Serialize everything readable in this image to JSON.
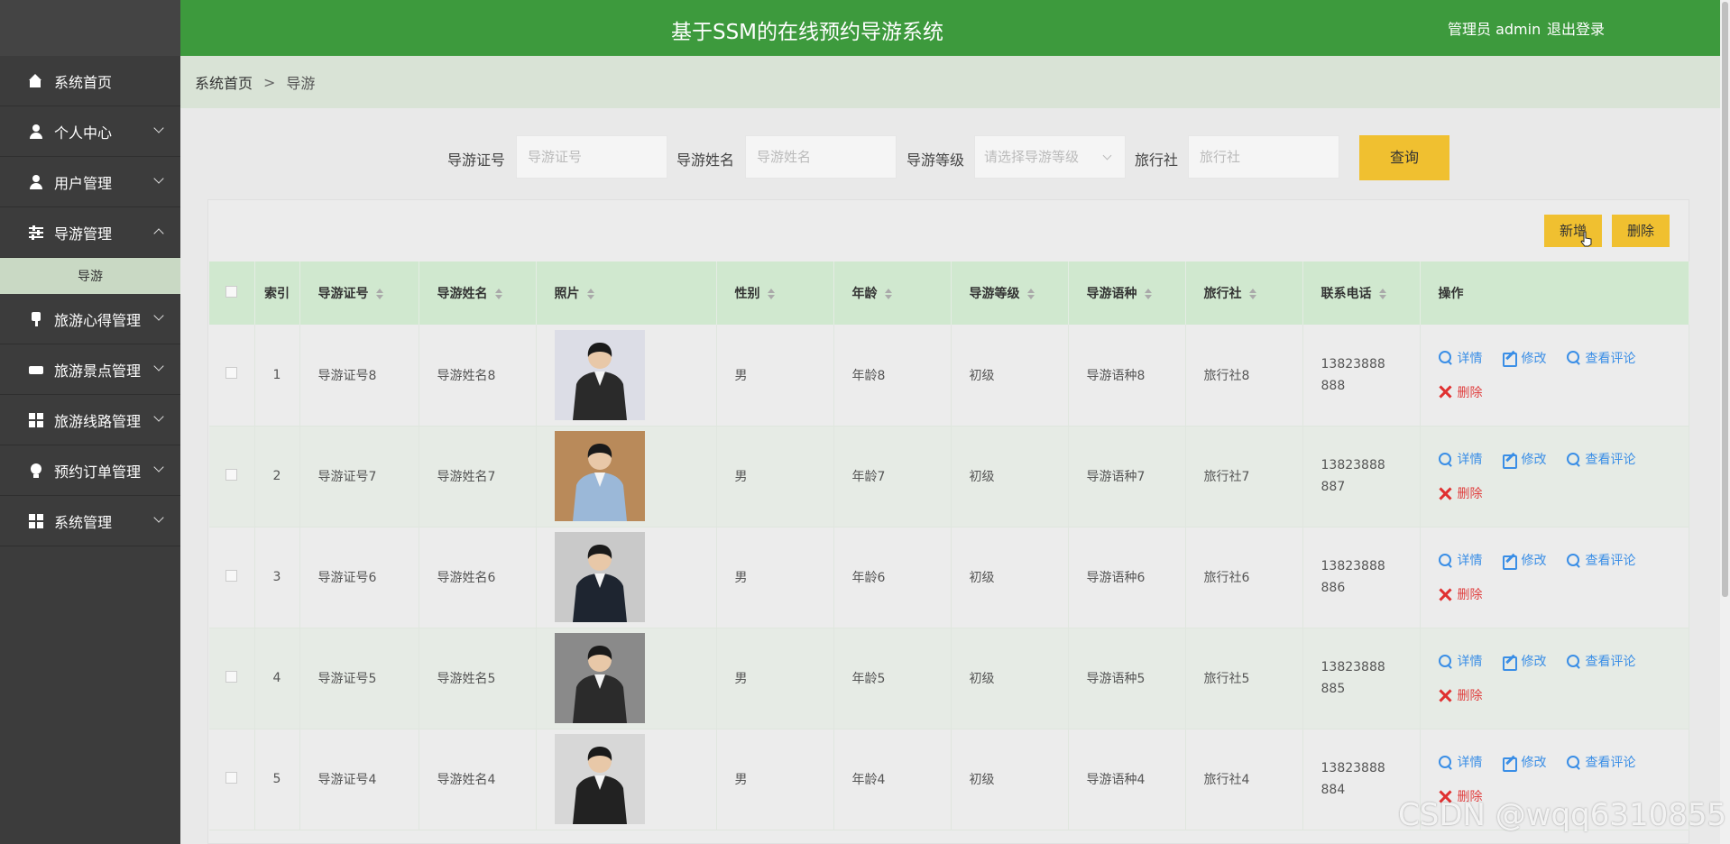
{
  "header": {
    "title": "基于SSM的在线预约导游系统",
    "user": "管理员 admin",
    "logout": "退出登录"
  },
  "sidebar": {
    "items": [
      {
        "label": "系统首页",
        "icon": "home-icon"
      },
      {
        "label": "个人中心",
        "icon": "user-icon"
      },
      {
        "label": "用户管理",
        "icon": "user-icon"
      },
      {
        "label": "导游管理",
        "icon": "sliders-icon"
      },
      {
        "label": "旅游心得管理",
        "icon": "pen-icon"
      },
      {
        "label": "旅游景点管理",
        "icon": "ticket-icon"
      },
      {
        "label": "旅游线路管理",
        "icon": "grid-icon"
      },
      {
        "label": "预约订单管理",
        "icon": "bulb-icon"
      },
      {
        "label": "系统管理",
        "icon": "grid-icon"
      }
    ],
    "sub_item": "导游"
  },
  "breadcrumb": {
    "home": "系统首页",
    "sep": ">",
    "current": "导游"
  },
  "search": {
    "id_label": "导游证号",
    "id_placeholder": "导游证号",
    "name_label": "导游姓名",
    "name_placeholder": "导游姓名",
    "level_label": "导游等级",
    "level_placeholder": "请选择导游等级",
    "agency_label": "旅行社",
    "agency_placeholder": "旅行社",
    "query_button": "查询"
  },
  "toolbar": {
    "add": "新增",
    "delete": "删除"
  },
  "table": {
    "headers": {
      "index": "索引",
      "guide_id": "导游证号",
      "guide_name": "导游姓名",
      "photo": "照片",
      "gender": "性别",
      "age": "年龄",
      "level": "导游等级",
      "language": "导游语种",
      "agency": "旅行社",
      "phone": "联系电话",
      "ops": "操作"
    },
    "ops": {
      "detail": "详情",
      "edit": "修改",
      "comment": "查看评论",
      "delete": "删除"
    },
    "rows": [
      {
        "index": "1",
        "guide_id": "导游证号8",
        "guide_name": "导游姓名8",
        "gender": "男",
        "age": "年龄8",
        "level": "初级",
        "language": "导游语种8",
        "agency": "旅行社8",
        "phone": "13823888888"
      },
      {
        "index": "2",
        "guide_id": "导游证号7",
        "guide_name": "导游姓名7",
        "gender": "男",
        "age": "年龄7",
        "level": "初级",
        "language": "导游语种7",
        "agency": "旅行社7",
        "phone": "13823888887"
      },
      {
        "index": "3",
        "guide_id": "导游证号6",
        "guide_name": "导游姓名6",
        "gender": "男",
        "age": "年龄6",
        "level": "初级",
        "language": "导游语种6",
        "agency": "旅行社6",
        "phone": "13823888886"
      },
      {
        "index": "4",
        "guide_id": "导游证号5",
        "guide_name": "导游姓名5",
        "gender": "男",
        "age": "年龄5",
        "level": "初级",
        "language": "导游语种5",
        "agency": "旅行社5",
        "phone": "13823888885"
      },
      {
        "index": "5",
        "guide_id": "导游证号4",
        "guide_name": "导游姓名4",
        "gender": "男",
        "age": "年龄4",
        "level": "初级",
        "language": "导游语种4",
        "agency": "旅行社4",
        "phone": "13823888884"
      }
    ]
  },
  "watermark": "CSDN @wqq6310855",
  "colors": {
    "header": "#3d9a3d",
    "sidebar": "#3c3c3c",
    "button": "#f0c030",
    "link": "#3a8ee6",
    "danger": "#e04040"
  }
}
